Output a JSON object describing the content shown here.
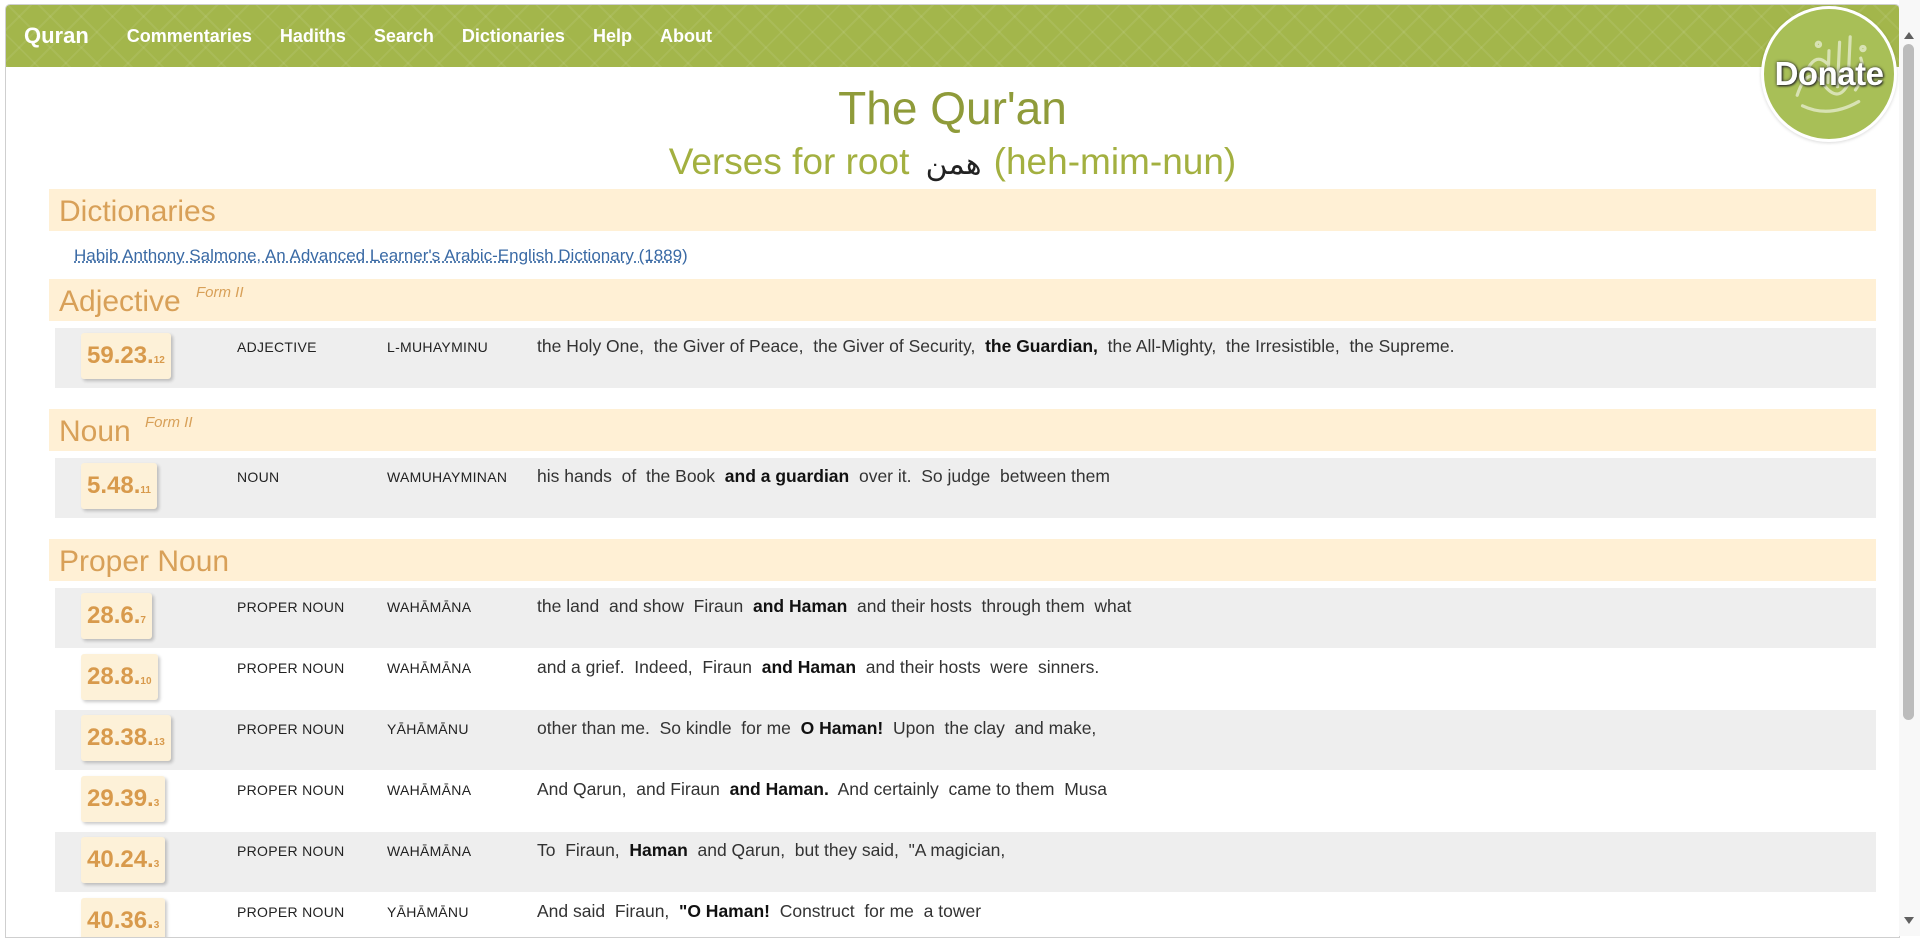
{
  "nav": {
    "brand": "Quran",
    "items": [
      "Commentaries",
      "Hadiths",
      "Search",
      "Dictionaries",
      "Help",
      "About"
    ],
    "donate": "Donate"
  },
  "title": "The Qur'an",
  "subtitle": {
    "prefix": "Verses for root",
    "root_arabic": "همن",
    "root_translit": "(heh-mim-nun)"
  },
  "dictionaries": {
    "heading": "Dictionaries",
    "link": "Habib Anthony Salmone, An Advanced Learner's Arabic-English Dictionary (1889)"
  },
  "sections": [
    {
      "title": "Adjective",
      "form": "Form II",
      "rows": [
        {
          "ref": "59.23.",
          "word": "12",
          "pos": "ADJECTIVE",
          "translit": "L-MUHAYMINU",
          "parts": [
            {
              "t": "the Holy One,  the Giver of Peace,  the Giver of Security,  ",
              "b": false
            },
            {
              "t": "the Guardian,",
              "b": true
            },
            {
              "t": "  the All-Mighty,  the Irresistible,  the Supreme.",
              "b": false
            }
          ]
        }
      ]
    },
    {
      "title": "Noun",
      "form": "Form II",
      "rows": [
        {
          "ref": "5.48.",
          "word": "11",
          "pos": "NOUN",
          "translit": "WAMUHAYMINAN",
          "parts": [
            {
              "t": "his hands  of  the Book  ",
              "b": false
            },
            {
              "t": "and a guardian",
              "b": true
            },
            {
              "t": "  over it.  So judge  between them",
              "b": false
            }
          ]
        }
      ]
    },
    {
      "title": "Proper Noun",
      "form": "",
      "rows": [
        {
          "ref": "28.6.",
          "word": "7",
          "pos": "PROPER NOUN",
          "translit": "WAHĀMĀNA",
          "parts": [
            {
              "t": "the land  and show  Firaun  ",
              "b": false
            },
            {
              "t": "and Haman",
              "b": true
            },
            {
              "t": "  and their hosts  through them  what",
              "b": false
            }
          ]
        },
        {
          "ref": "28.8.",
          "word": "10",
          "pos": "PROPER NOUN",
          "translit": "WAHĀMĀNA",
          "parts": [
            {
              "t": "and a grief.  Indeed,  Firaun  ",
              "b": false
            },
            {
              "t": "and Haman",
              "b": true
            },
            {
              "t": "  and their hosts  were  sinners.",
              "b": false
            }
          ]
        },
        {
          "ref": "28.38.",
          "word": "13",
          "pos": "PROPER NOUN",
          "translit": "YĀHĀMĀNU",
          "parts": [
            {
              "t": "other than me.  So kindle  for me  ",
              "b": false
            },
            {
              "t": "O Haman!",
              "b": true
            },
            {
              "t": "  Upon  the clay  and make,",
              "b": false
            }
          ]
        },
        {
          "ref": "29.39.",
          "word": "3",
          "pos": "PROPER NOUN",
          "translit": "WAHĀMĀNA",
          "parts": [
            {
              "t": "And Qarun,  and Firaun  ",
              "b": false
            },
            {
              "t": "and Haman.",
              "b": true
            },
            {
              "t": "  And certainly  came to them  Musa",
              "b": false
            }
          ]
        },
        {
          "ref": "40.24.",
          "word": "3",
          "pos": "PROPER NOUN",
          "translit": "WAHĀMĀNA",
          "parts": [
            {
              "t": "To  Firaun,  ",
              "b": false
            },
            {
              "t": "Haman",
              "b": true
            },
            {
              "t": "  and Qarun,  but they said,  \"A magician,",
              "b": false
            }
          ]
        },
        {
          "ref": "40.36.",
          "word": "3",
          "pos": "PROPER NOUN",
          "translit": "YĀHĀMĀNU",
          "parts": [
            {
              "t": "And said  Firaun,  ",
              "b": false
            },
            {
              "t": "\"O Haman!",
              "b": true
            },
            {
              "t": "  Construct  for me  a tower",
              "b": false
            }
          ]
        }
      ]
    }
  ],
  "colors": {
    "nav_green": "#a3b64b",
    "title_green": "#8f9b3a",
    "section_bg": "#fff0d5",
    "section_text": "#d8a058",
    "verse_ref": "#d89a4c",
    "row_shade": "#eeeeee"
  },
  "icons": [
    "calligraphy-logo-icon",
    "scroll-up-icon",
    "scroll-down-icon"
  ]
}
